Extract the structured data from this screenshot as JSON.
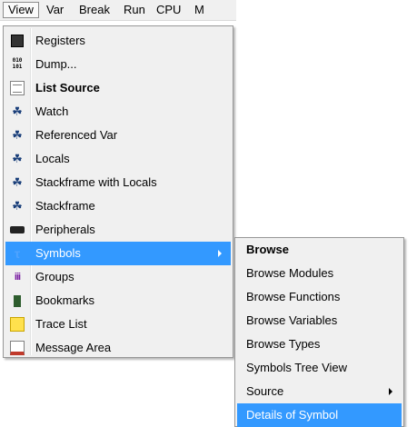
{
  "menubar": {
    "items": [
      {
        "label": "View"
      },
      {
        "label": "Var"
      },
      {
        "label": "Break"
      },
      {
        "label": "Run"
      },
      {
        "label": "CPU"
      },
      {
        "label": "M"
      }
    ]
  },
  "view_menu": {
    "items": [
      {
        "label": "Registers",
        "icon": "cpu-chip-icon"
      },
      {
        "label": "Dump...",
        "icon": "binary-dump-icon"
      },
      {
        "label": "List Source",
        "icon": "list-source-icon"
      },
      {
        "label": "Watch",
        "icon": "watch-glasses-icon"
      },
      {
        "label": "Referenced Var",
        "icon": "referenced-var-glasses-icon"
      },
      {
        "label": "Locals",
        "icon": "locals-glasses-icon"
      },
      {
        "label": "Stackframe with Locals",
        "icon": "stackframe-locals-icon"
      },
      {
        "label": "Stackframe",
        "icon": "stackframe-icon"
      },
      {
        "label": "Peripherals",
        "icon": "peripherals-chip-icon"
      },
      {
        "label": "Symbols",
        "icon": "symbols-icon"
      },
      {
        "label": "Groups",
        "icon": "groups-icon"
      },
      {
        "label": "Bookmarks",
        "icon": "bookmark-icon"
      },
      {
        "label": "Trace List",
        "icon": "trace-list-icon"
      },
      {
        "label": "Message Area",
        "icon": "message-area-icon"
      }
    ]
  },
  "symbols_submenu": {
    "items": [
      {
        "label": "Browse"
      },
      {
        "label": "Browse Modules"
      },
      {
        "label": "Browse Functions"
      },
      {
        "label": "Browse Variables"
      },
      {
        "label": "Browse Types"
      },
      {
        "label": "Symbols Tree View"
      },
      {
        "label": "Source"
      },
      {
        "label": "Details of Symbol"
      }
    ]
  },
  "colors": {
    "highlight": "#3399ff",
    "menu_background": "#f0f0f0"
  }
}
